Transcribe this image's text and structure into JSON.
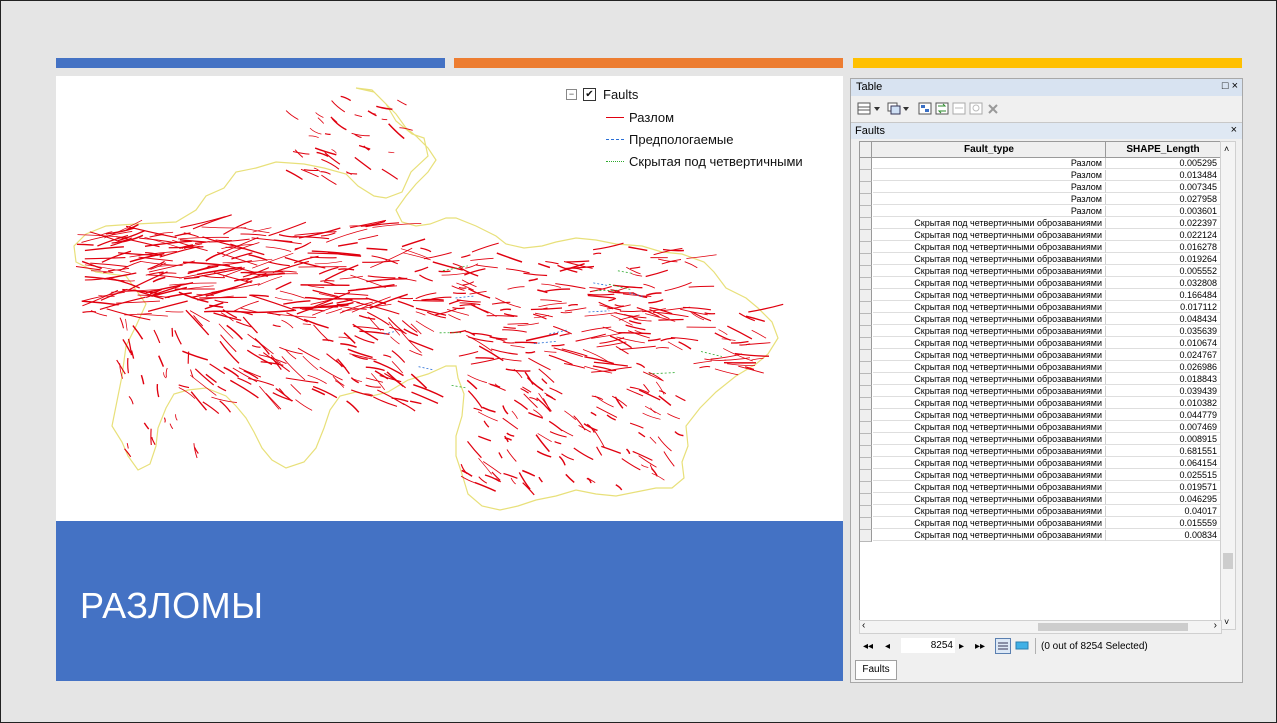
{
  "slide_title": "РАЗЛОМЫ",
  "colors": {
    "blue": "#4472c4",
    "orange": "#ed7d31",
    "gold": "#ffc000",
    "fault_red": "#e0000f",
    "suspected_blue": "#2a6fd6",
    "hidden_green": "#2eaa2e",
    "border_yellow": "#e8e07a"
  },
  "legend": {
    "layer": "Faults",
    "items": [
      {
        "label": "Разлом"
      },
      {
        "label": "Предпологаемые"
      },
      {
        "label": "Скрытая под четвертичными"
      }
    ]
  },
  "table": {
    "window_title": "Table",
    "window_buttons": "□ ×",
    "tab_title": "Faults",
    "close": "×",
    "columns": [
      "Fault_type",
      "SHAPE_Length"
    ],
    "rows": [
      [
        "Разлом",
        "0.005295"
      ],
      [
        "Разлом",
        "0.013484"
      ],
      [
        "Разлом",
        "0.007345"
      ],
      [
        "Разлом",
        "0.027958"
      ],
      [
        "Разлом",
        "0.003601"
      ],
      [
        "Скрытая под четвертичными оброзаваниями",
        "0.022397"
      ],
      [
        "Скрытая под четвертичными оброзаваниями",
        "0.022124"
      ],
      [
        "Скрытая под четвертичными оброзаваниями",
        "0.016278"
      ],
      [
        "Скрытая под четвертичными оброзаваниями",
        "0.019264"
      ],
      [
        "Скрытая под четвертичными оброзаваниями",
        "0.005552"
      ],
      [
        "Скрытая под четвертичными оброзаваниями",
        "0.032808"
      ],
      [
        "Скрытая под четвертичными оброзаваниями",
        "0.166484"
      ],
      [
        "Скрытая под четвертичными оброзаваниями",
        "0.017112"
      ],
      [
        "Скрытая под четвертичными оброзаваниями",
        "0.048434"
      ],
      [
        "Скрытая под четвертичными оброзаваниями",
        "0.035639"
      ],
      [
        "Скрытая под четвертичными оброзаваниями",
        "0.010674"
      ],
      [
        "Скрытая под четвертичными оброзаваниями",
        "0.024767"
      ],
      [
        "Скрытая под четвертичными оброзаваниями",
        "0.026986"
      ],
      [
        "Скрытая под четвертичными оброзаваниями",
        "0.018843"
      ],
      [
        "Скрытая под четвертичными оброзаваниями",
        "0.039439"
      ],
      [
        "Скрытая под четвертичными оброзаваниями",
        "0.010382"
      ],
      [
        "Скрытая под четвертичными оброзаваниями",
        "0.044779"
      ],
      [
        "Скрытая под четвертичными оброзаваниями",
        "0.007469"
      ],
      [
        "Скрытая под четвертичными оброзаваниями",
        "0.008915"
      ],
      [
        "Скрытая под четвертичными оброзаваниями",
        "0.681551"
      ],
      [
        "Скрытая под четвертичными оброзаваниями",
        "0.064154"
      ],
      [
        "Скрытая под четвертичными оброзаваниями",
        "0.025515"
      ],
      [
        "Скрытая под четвертичными оброзаваниями",
        "0.019571"
      ],
      [
        "Скрытая под четвертичными оброзаваниями",
        "0.046295"
      ],
      [
        "Скрытая под четвертичными оброзаваниями",
        "0.04017"
      ],
      [
        "Скрытая под четвертичными оброзаваниями",
        "0.015559"
      ],
      [
        "Скрытая под четвертичными оброзаваниями",
        "0.00834"
      ]
    ],
    "nav": {
      "first": "◂◂",
      "prev": "◂",
      "current": "8254",
      "next": "▸",
      "last": "▸▸",
      "selection_status": "(0 out of 8254 Selected)"
    },
    "bottom_tab": "Faults"
  }
}
